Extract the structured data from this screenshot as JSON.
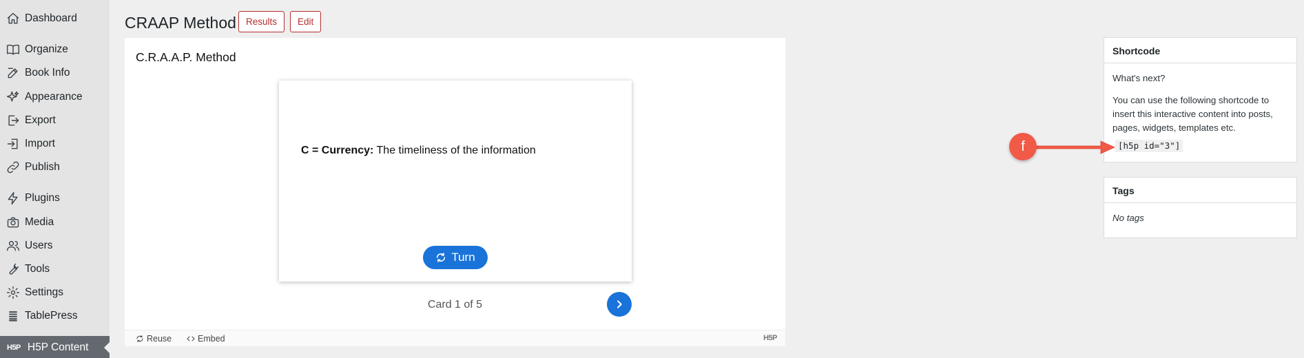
{
  "sidebar": {
    "items": [
      {
        "label": "Dashboard",
        "icon": "home-icon"
      },
      {
        "label": "Organize",
        "icon": "book-icon"
      },
      {
        "label": "Book Info",
        "icon": "edit-icon"
      },
      {
        "label": "Appearance",
        "icon": "sparkle-icon"
      },
      {
        "label": "Export",
        "icon": "export-icon"
      },
      {
        "label": "Import",
        "icon": "import-icon"
      },
      {
        "label": "Publish",
        "icon": "link-icon"
      },
      {
        "label": "Plugins",
        "icon": "bolt-icon"
      },
      {
        "label": "Media",
        "icon": "camera-icon"
      },
      {
        "label": "Users",
        "icon": "users-icon"
      },
      {
        "label": "Tools",
        "icon": "wrench-icon"
      },
      {
        "label": "Settings",
        "icon": "gear-icon"
      },
      {
        "label": "TablePress",
        "icon": "table-icon"
      }
    ],
    "active_item": {
      "label": "H5P Content",
      "logo": "H5P"
    }
  },
  "header": {
    "title": "CRAAP Method",
    "results_label": "Results",
    "edit_label": "Edit"
  },
  "content": {
    "title": "C.R.A.A.P. Method",
    "card": {
      "term": "C = Currency:",
      "definition": " The timeliness of the information",
      "turn_label": "Turn"
    },
    "counter": "Card 1 of 5",
    "footer": {
      "reuse_label": "Reuse",
      "embed_label": "Embed",
      "brand": "H5P"
    }
  },
  "shortcode_box": {
    "title": "Shortcode",
    "whats_next": "What's next?",
    "instructions": "You can use the following shortcode to insert this interactive content into posts, pages, widgets, templates etc.",
    "code": "[h5p id=\"3\"]"
  },
  "tags_box": {
    "title": "Tags",
    "empty_text": "No tags"
  },
  "annotation": {
    "label": "f",
    "color": "#f05a46"
  },
  "colors": {
    "accent_blue": "#1a73d9",
    "danger_red": "#b32d2e",
    "sidebar_bg": "#e4e4e4",
    "active_bg": "#646970"
  }
}
